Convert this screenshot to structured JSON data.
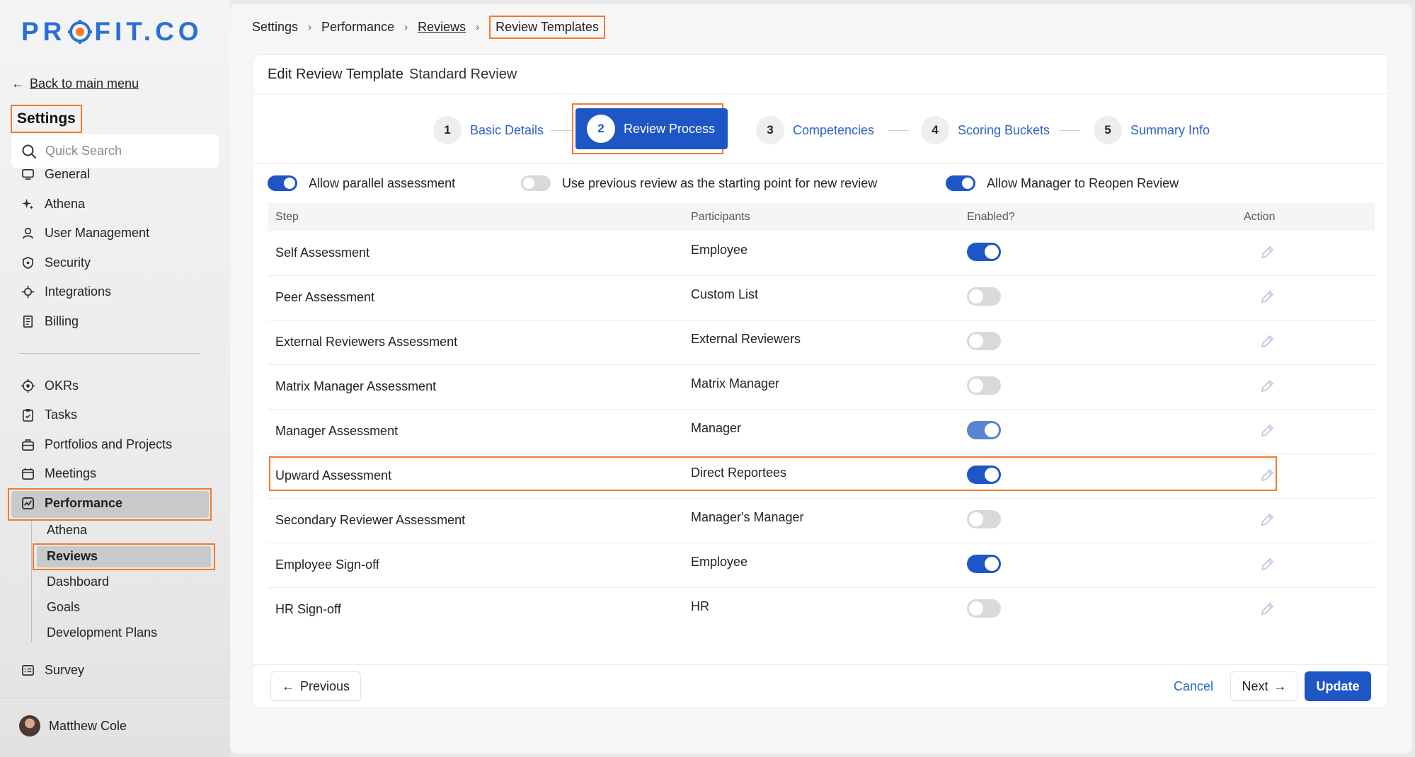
{
  "sidebar": {
    "logo": {
      "left": "PR",
      "right": "FIT.CO"
    },
    "back_label": "Back to main menu",
    "title": "Settings",
    "search_placeholder": "Quick Search",
    "settings_items": [
      {
        "label": "General",
        "icon": "monitor-icon"
      },
      {
        "label": "Athena",
        "icon": "sparkle-icon"
      },
      {
        "label": "User Management",
        "icon": "user-icon"
      },
      {
        "label": "Security",
        "icon": "shield-icon"
      },
      {
        "label": "Integrations",
        "icon": "gear-icon"
      },
      {
        "label": "Billing",
        "icon": "receipt-icon"
      }
    ],
    "app_items": [
      {
        "label": "OKRs",
        "icon": "target-icon"
      },
      {
        "label": "Tasks",
        "icon": "clipboard-icon"
      },
      {
        "label": "Portfolios and Projects",
        "icon": "briefcase-icon"
      },
      {
        "label": "Meetings",
        "icon": "calendar-icon"
      },
      {
        "label": "Performance",
        "icon": "chart-icon"
      }
    ],
    "performance_sub": [
      "Athena",
      "Reviews",
      "Dashboard",
      "Goals",
      "Development Plans"
    ],
    "survey_label": "Survey",
    "user_name": "Matthew Cole"
  },
  "breadcrumb": {
    "items": [
      "Settings",
      "Performance",
      "Reviews"
    ],
    "current": "Review Templates"
  },
  "card": {
    "title": "Edit Review Template",
    "template_name": "Standard Review"
  },
  "steps": [
    {
      "num": "1",
      "label": "Basic Details"
    },
    {
      "num": "2",
      "label": "Review Process"
    },
    {
      "num": "3",
      "label": "Competencies"
    },
    {
      "num": "4",
      "label": "Scoring Buckets"
    },
    {
      "num": "5",
      "label": "Summary Info"
    }
  ],
  "options": [
    {
      "label": "Allow parallel assessment",
      "enabled": true
    },
    {
      "label": "Use previous review as the starting point for new review",
      "enabled": false
    },
    {
      "label": "Allow Manager to Reopen Review",
      "enabled": true
    }
  ],
  "table": {
    "headers": [
      "Step",
      "Participants",
      "Enabled?",
      "Action"
    ],
    "rows": [
      {
        "step": "Self Assessment",
        "participants": "Employee",
        "enabled": true
      },
      {
        "step": "Peer Assessment",
        "participants": "Custom List",
        "enabled": false
      },
      {
        "step": "External Reviewers Assessment",
        "participants": "External Reviewers",
        "enabled": false
      },
      {
        "step": "Matrix Manager Assessment",
        "participants": "Matrix Manager",
        "enabled": false
      },
      {
        "step": "Manager Assessment",
        "participants": "Manager",
        "enabled": true
      },
      {
        "step": "Upward Assessment",
        "participants": "Direct Reportees",
        "enabled": true
      },
      {
        "step": "Secondary Reviewer Assessment",
        "participants": "Manager's Manager",
        "enabled": false
      },
      {
        "step": "Employee Sign-off",
        "participants": "Employee",
        "enabled": true
      },
      {
        "step": "HR Sign-off",
        "participants": "HR",
        "enabled": false
      }
    ]
  },
  "footer": {
    "previous": "Previous",
    "cancel": "Cancel",
    "next": "Next",
    "update": "Update"
  },
  "colors": {
    "accent": "#1e56c6",
    "highlight": "#f07b2d",
    "link": "#2b64c9"
  }
}
